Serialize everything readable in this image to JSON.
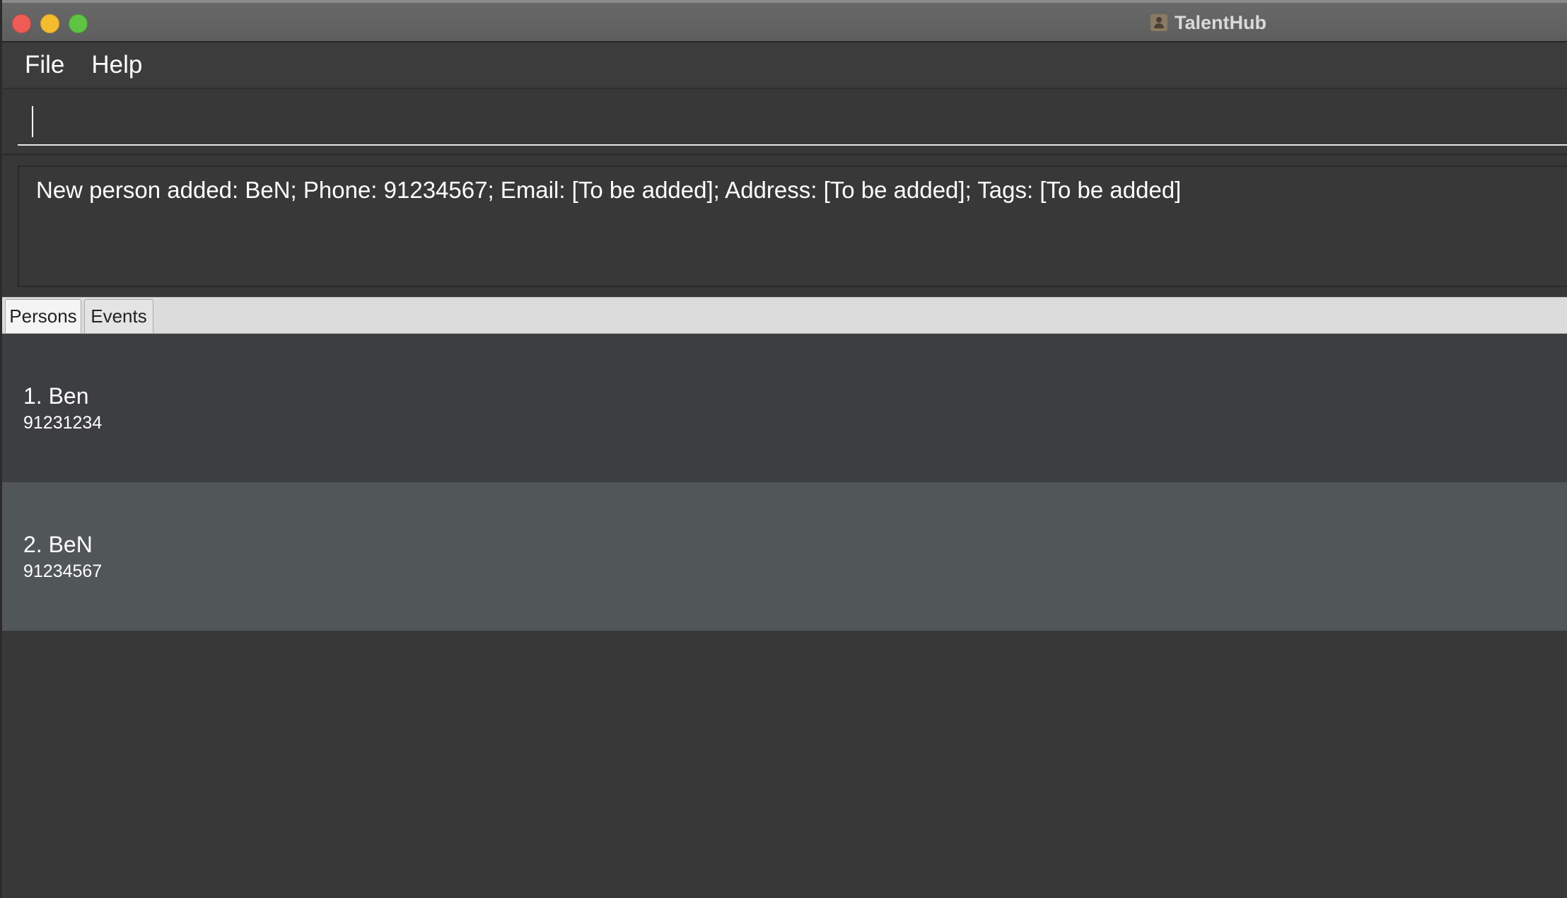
{
  "window": {
    "title": "TalentHub",
    "app_icon": "person-icon"
  },
  "menu": {
    "items": [
      {
        "label": "File"
      },
      {
        "label": "Help"
      }
    ]
  },
  "command": {
    "value": "",
    "placeholder": ""
  },
  "result": {
    "message": "New person added: BeN; Phone: 91234567; Email: [To be added]; Address: [To be added]; Tags: [To be added]"
  },
  "tabs": [
    {
      "label": "Persons",
      "selected": true
    },
    {
      "label": "Events",
      "selected": false
    }
  ],
  "persons": [
    {
      "title": "1. Ben",
      "phone": "91231234"
    },
    {
      "title": "2. BeN",
      "phone": "91234567"
    }
  ],
  "colors": {
    "background": "#383838",
    "row_default": "#3c3e41",
    "row_selected": "#515659",
    "tab_bar": "#dcdcdc",
    "close": "#ee5c55",
    "minimize": "#f5bb2f",
    "maximize": "#5fc444"
  }
}
